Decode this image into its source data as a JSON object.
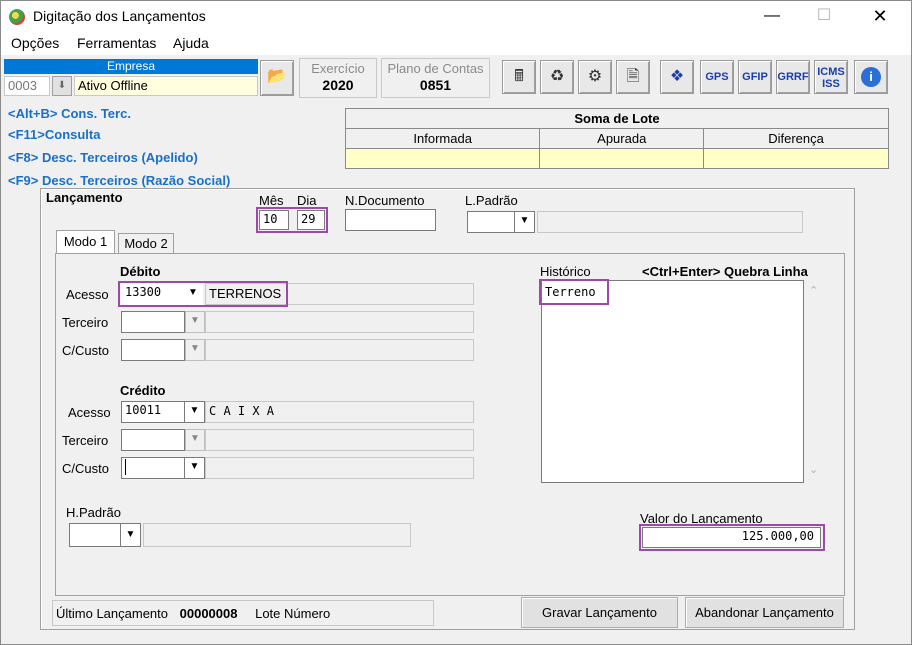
{
  "window": {
    "title": "Digitação dos Lançamentos"
  },
  "menu": {
    "opcoes": "Opções",
    "ferramentas": "Ferramentas",
    "ajuda": "Ajuda"
  },
  "empresa": {
    "header": "Empresa",
    "code": "0003",
    "name": "Ativo Offline"
  },
  "exercicio": {
    "label": "Exercício",
    "value": "2020"
  },
  "plano": {
    "label": "Plano de Contas",
    "value": "0851"
  },
  "toolbar": {
    "gps": "GPS",
    "gfip": "GFIP",
    "grrf": "GRRF",
    "icms_line1": "ICMS",
    "icms_line2": "ISS"
  },
  "shortcuts": [
    "<Alt+B> Cons. Terc.",
    "<F11>Consulta",
    "<F8> Desc. Terceiros (Apelido)",
    "<F9> Desc. Terceiros (Razão Social)"
  ],
  "soma_lote": {
    "title": "Soma de Lote",
    "cols": [
      "Informada",
      "Apurada",
      "Diferença"
    ]
  },
  "lancamento": {
    "title": "Lançamento",
    "mes_label": "Mês",
    "dia_label": "Dia",
    "mes": "10",
    "dia": "29",
    "ndoc_label": "N.Documento",
    "ndoc": "",
    "lpadrao_label": "L.Padrão"
  },
  "tabs": {
    "modo1": "Modo 1",
    "modo2": "Modo 2"
  },
  "debito": {
    "title": "Débito",
    "acesso_label": "Acesso",
    "acesso": "13300",
    "acesso_desc": "TERRENOS",
    "terceiro_label": "Terceiro",
    "custo_label": "C/Custo"
  },
  "credito": {
    "title": "Crédito",
    "acesso_label": "Acesso",
    "acesso": "10011",
    "acesso_desc": "C A I X A",
    "terceiro_label": "Terceiro",
    "custo_label": "C/Custo"
  },
  "historico": {
    "label": "Histórico",
    "hint": "<Ctrl+Enter> Quebra Linha",
    "text": "Terreno"
  },
  "hpadrao_label": "H.Padrão",
  "valor": {
    "label": "Valor do Lançamento",
    "value": "125.000,00"
  },
  "footer": {
    "ultimo_label": "Último Lançamento",
    "ultimo_value": "00000008",
    "lote_label": "Lote Número"
  },
  "buttons": {
    "gravar": "Gravar Lançamento",
    "abandonar": "Abandonar Lançamento"
  }
}
